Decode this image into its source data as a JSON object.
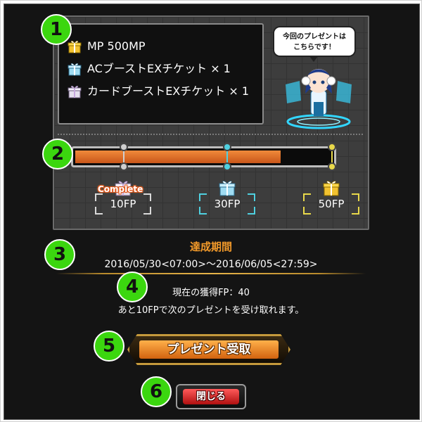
{
  "colors": {
    "badge": "#3bd60f",
    "accent_orange": "#f39a2a",
    "bar_fill": "#e0762a",
    "milestone_10": "#d9d9d9",
    "milestone_30": "#4fd0e0",
    "milestone_50": "#e8d84a"
  },
  "rewards": [
    {
      "icon": "gold-gift-icon",
      "text": "MP 500MP"
    },
    {
      "icon": "blue-gift-icon",
      "text": "ACブーストEXチケット × 1"
    },
    {
      "icon": "silver-gift-icon",
      "text": "カードブーストEXチケット × 1"
    }
  ],
  "speech": {
    "line1": "今回のプレゼントは",
    "line2": "こちらです！"
  },
  "progress": {
    "current_fp": 40,
    "max_fp": 50
  },
  "milestones": [
    {
      "label": "10FP",
      "status": "Complete",
      "icon": "silver-gift-icon"
    },
    {
      "label": "30FP",
      "status": "",
      "icon": "blue-gift-icon"
    },
    {
      "label": "50FP",
      "status": "",
      "icon": "gold-gift-icon"
    }
  ],
  "period": {
    "title": "達成期間",
    "range": "2016/05/30<07:00>～2016/06/05<27:59>"
  },
  "fp_status": {
    "current": "現在の獲得FP：40",
    "next": "あと10FPで次のプレゼントを受け取れます。"
  },
  "buttons": {
    "receive": "プレゼント受取",
    "close": "閉じる"
  },
  "badges": [
    "1",
    "2",
    "3",
    "4",
    "5",
    "6"
  ]
}
